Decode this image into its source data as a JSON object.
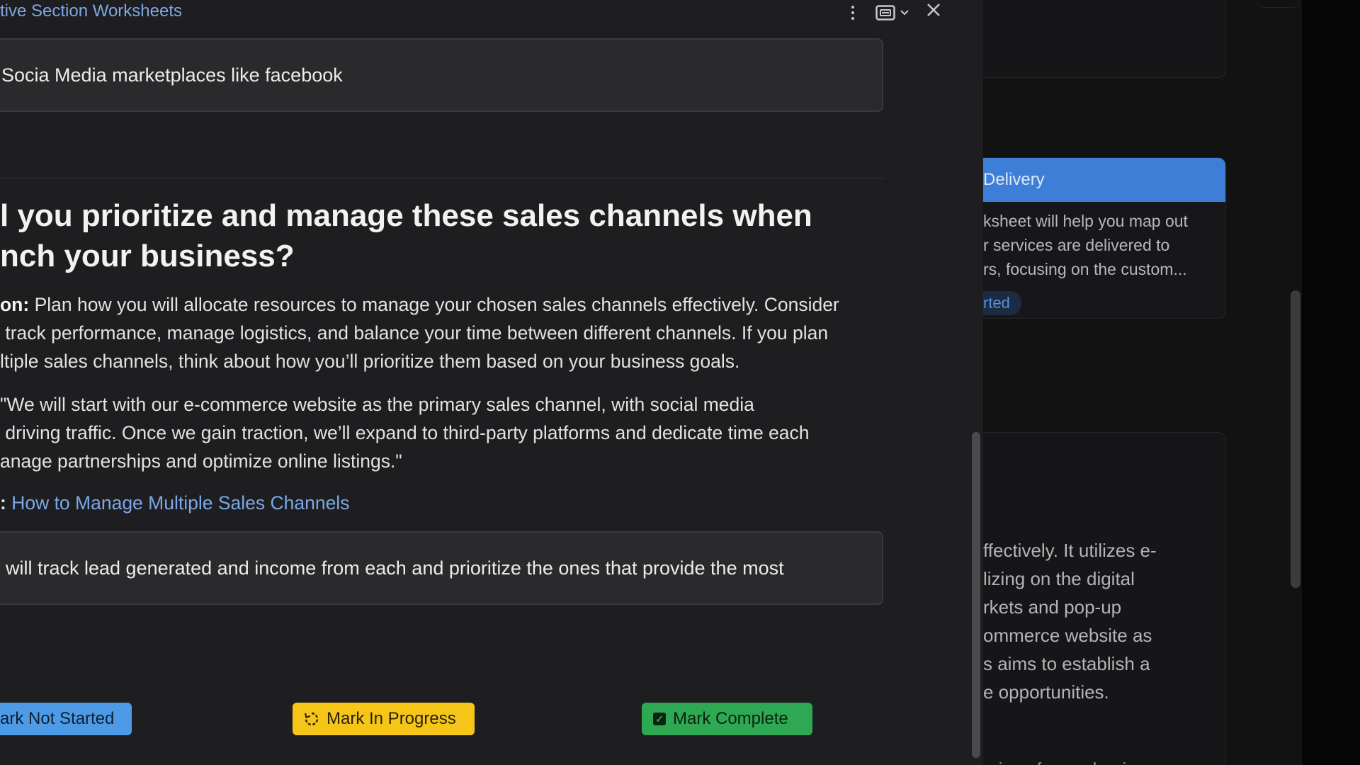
{
  "window": {
    "title": "tive Section Worksheets"
  },
  "answers": {
    "sales_channels": "Socia Media marketplaces like facebook",
    "prioritize": "will track lead generated and income from each and prioritize the ones that provide the most"
  },
  "question": {
    "text": "l you prioritize and manage these sales channels when\nnch your business?"
  },
  "instructions": {
    "label": "on:",
    "text": " Plan how you will allocate resources to manage your chosen sales channels effectively. Consider\n track performance, manage logistics, and balance your time between different channels. If you plan\nltiple sales channels, think about how you’ll prioritize them based on your business goals."
  },
  "example": {
    "text": "\"We will start with our e-commerce website as the primary sales channel, with social media\n driving traffic. Once we gain traction, we’ll expand to third-party platforms and dedicate time each\nanage partnerships and optimize online listings.\""
  },
  "resource": {
    "prefix": ": ",
    "link": "How to Manage Multiple Sales Channels"
  },
  "buttons": {
    "not_started": "ark Not Started",
    "in_progress": "Mark In Progress",
    "complete": "Mark Complete"
  },
  "background": {
    "card_title": "Delivery",
    "card_desc": "ksheet will help you map out\nr services are delivered to\nrs, focusing on the custom...",
    "card_status": "rted",
    "summary_text": "ffectively. It utilizes e-\nlizing on the digital\nrkets and pop-up\nommerce website as\ns aims to establish a\ne opportunities.",
    "cut_text": "rvices for packaging"
  },
  "colors": {
    "accent_link": "#7aa8e6",
    "not_started": "#4d9be6",
    "in_progress": "#f5c518",
    "complete": "#2ea853"
  }
}
